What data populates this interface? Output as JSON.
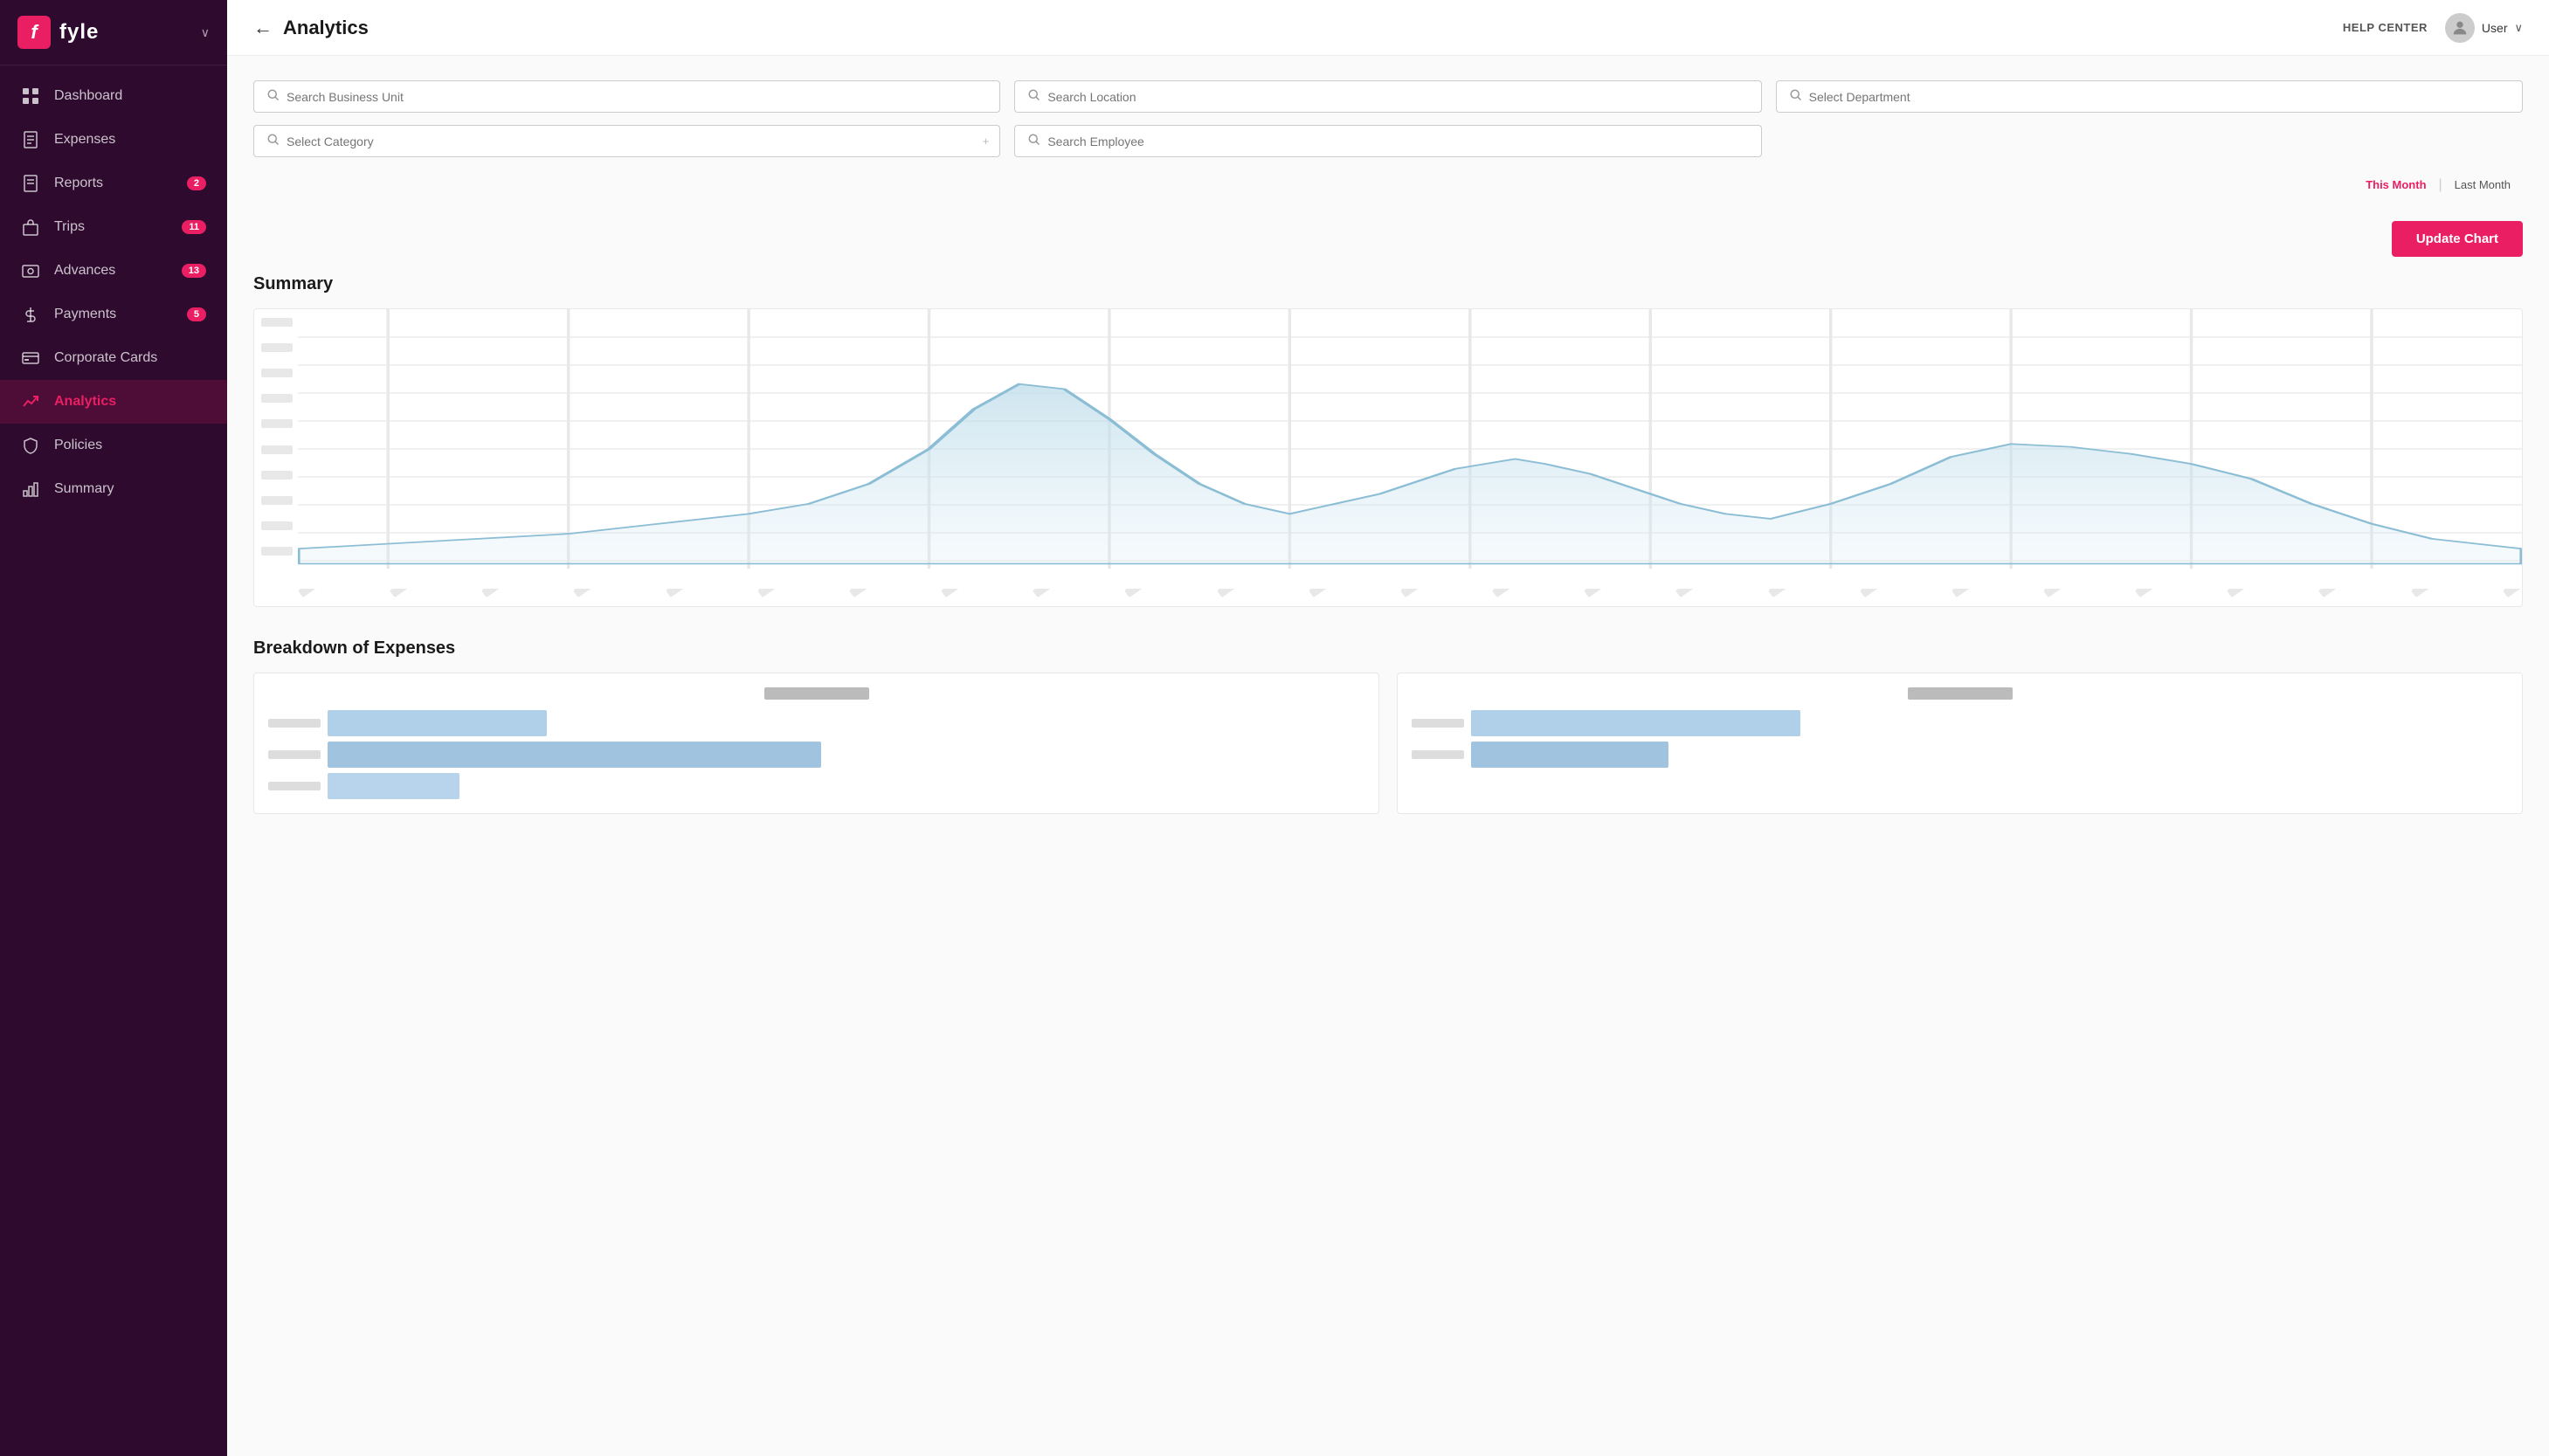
{
  "app": {
    "logo_letter": "f",
    "logo_text": "fyle",
    "chevron": "∨"
  },
  "sidebar": {
    "items": [
      {
        "id": "dashboard",
        "label": "Dashboard",
        "icon": "grid",
        "badge": null,
        "active": false
      },
      {
        "id": "expenses",
        "label": "Expenses",
        "icon": "receipt",
        "badge": null,
        "active": false
      },
      {
        "id": "reports",
        "label": "Reports",
        "icon": "document",
        "badge": "2",
        "active": false
      },
      {
        "id": "trips",
        "label": "Trips",
        "icon": "briefcase",
        "badge": "11",
        "active": false
      },
      {
        "id": "advances",
        "label": "Advances",
        "icon": "card",
        "badge": "13",
        "active": false
      },
      {
        "id": "payments",
        "label": "Payments",
        "icon": "dollar",
        "badge": "5",
        "active": false
      },
      {
        "id": "corporate-cards",
        "label": "Corporate Cards",
        "icon": "creditcard",
        "badge": null,
        "active": false
      },
      {
        "id": "analytics",
        "label": "Analytics",
        "icon": "trending",
        "badge": null,
        "active": true
      },
      {
        "id": "policies",
        "label": "Policies",
        "icon": "shield",
        "badge": null,
        "active": false
      },
      {
        "id": "summary",
        "label": "Summary",
        "icon": "barchart",
        "badge": null,
        "active": false
      }
    ]
  },
  "topbar": {
    "back_label": "←",
    "title": "Analytics",
    "help_center": "HELP CENTER",
    "user_name": "User",
    "user_chevron": "∨"
  },
  "filters": {
    "business_unit_placeholder": "Search Business Unit",
    "location_placeholder": "Search Location",
    "department_placeholder": "Select Department",
    "category_placeholder": "Select Category",
    "employee_placeholder": "Search Employee"
  },
  "time_filters": {
    "this_month": "This Month",
    "last_month": "Last Month",
    "active": "this_month"
  },
  "update_chart_btn": "Update Chart",
  "sections": {
    "summary_title": "Summary",
    "breakdown_title": "Breakdown of Expenses"
  },
  "chart": {
    "y_labels": [
      "",
      "",
      "",
      "",
      "",
      "",
      "",
      "",
      "",
      "",
      "",
      "",
      ""
    ],
    "x_labels": [
      "",
      "",
      "",
      "",
      "",
      "",
      "",
      "",
      "",
      "",
      "",
      "",
      "",
      "",
      "",
      "",
      "",
      "",
      "",
      "",
      "",
      "",
      "",
      "",
      ""
    ]
  }
}
